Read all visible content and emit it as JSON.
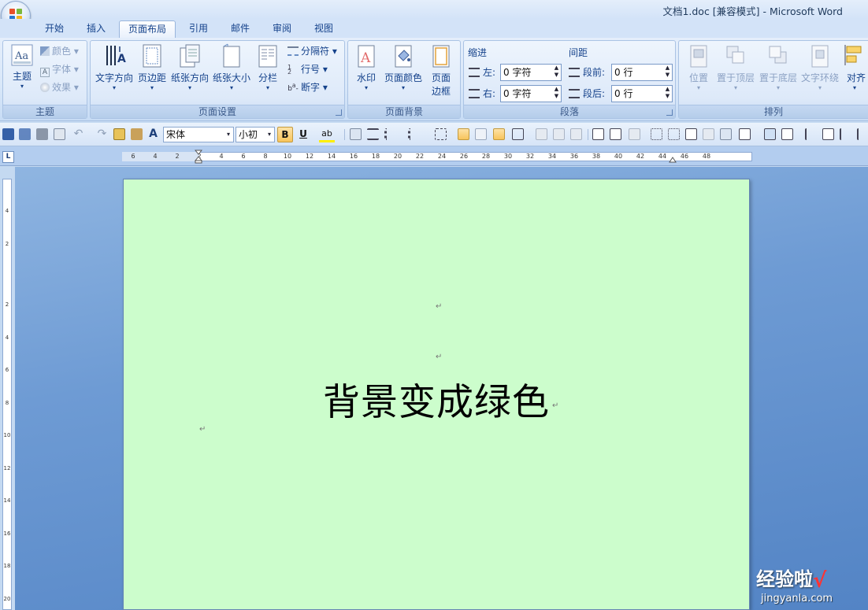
{
  "window": {
    "title": "文档1.doc [兼容模式] - Microsoft Word"
  },
  "tabs": [
    {
      "label": "开始",
      "active": false
    },
    {
      "label": "插入",
      "active": false
    },
    {
      "label": "页面布局",
      "active": true
    },
    {
      "label": "引用",
      "active": false
    },
    {
      "label": "邮件",
      "active": false
    },
    {
      "label": "审阅",
      "active": false
    },
    {
      "label": "视图",
      "active": false
    }
  ],
  "ribbon": {
    "theme": {
      "label": "主题",
      "themes": "主题",
      "colors": "颜色",
      "fonts": "字体",
      "effects": "效果"
    },
    "page_setup": {
      "label": "页面设置",
      "text_direction": "文字方向",
      "margins": "页边距",
      "orientation": "纸张方向",
      "size": "纸张大小",
      "columns": "分栏",
      "breaks": "分隔符",
      "line_numbers": "行号",
      "hyphenation": "断字"
    },
    "page_background": {
      "label": "页面背景",
      "watermark": "水印",
      "page_color": "页面颜色",
      "page_borders_1": "页面",
      "page_borders_2": "边框",
      "page_color_value": "#ccfdcc"
    },
    "paragraph": {
      "label": "段落",
      "indent": "缩进",
      "spacing": "间距",
      "left_label": "左:",
      "left_value": "0 字符",
      "right_label": "右:",
      "right_value": "0 字符",
      "before_label": "段前:",
      "before_value": "0 行",
      "after_label": "段后:",
      "after_value": "0 行"
    },
    "arrange": {
      "label": "排列",
      "position": "位置",
      "bring_front": "置于顶层",
      "send_back": "置于底层",
      "text_wrap": "文字环绕",
      "align": "对齐"
    }
  },
  "toolbar": {
    "font_name": "宋体",
    "font_size": "小初",
    "bold": "B",
    "underline": "U",
    "highlight": "ab"
  },
  "ruler": {
    "h_labels": [
      "6",
      "4",
      "2",
      "2",
      "4",
      "6",
      "8",
      "10",
      "12",
      "14",
      "16",
      "18",
      "20",
      "22",
      "24",
      "26",
      "28",
      "30",
      "32",
      "34",
      "36",
      "38",
      "40",
      "42",
      "44",
      "46",
      "48"
    ],
    "v_labels": [
      "4",
      "2",
      "2",
      "4",
      "6",
      "8",
      "10",
      "12",
      "14",
      "16",
      "18",
      "20"
    ],
    "tab_stop": "L"
  },
  "document": {
    "text": "背景变成绿色",
    "mark": "↵"
  },
  "watermark": {
    "title": "经验啦",
    "check": "√",
    "url": "jingyanla.com"
  }
}
